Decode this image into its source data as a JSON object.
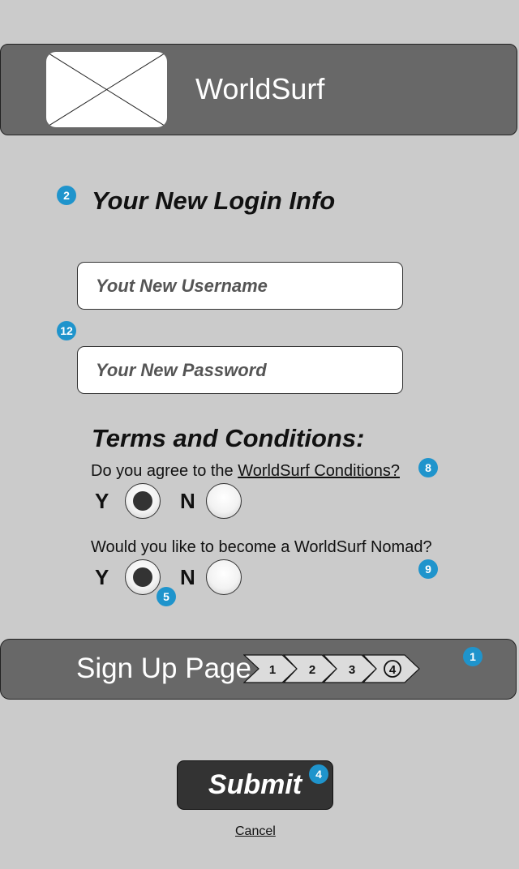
{
  "header": {
    "brand": "WorldSurf",
    "logo_icon": "image-placeholder-icon"
  },
  "form": {
    "title": "Your New Login Info",
    "username_placeholder": "Yout New Username",
    "password_placeholder": "Your New Password"
  },
  "terms": {
    "heading": "Terms and Conditions:",
    "q1_prefix": "Do you agree to the ",
    "q1_link": "WorldSurf Conditions?",
    "q1_selected": "Y",
    "q2": "Would you like to become a WorldSurf Nomad?",
    "q2_selected": "Y",
    "yes_label": "Y",
    "no_label": "N"
  },
  "progress": {
    "label": "Sign Up Page",
    "steps": [
      "1",
      "2",
      "3",
      "4"
    ],
    "current_step": 4
  },
  "actions": {
    "submit": "Submit",
    "cancel": "Cancel"
  },
  "annotations": {
    "title": "2",
    "fields": "12",
    "terms_q1": "8",
    "terms_q2": "9",
    "radio": "5",
    "progress": "1",
    "submit": "4"
  },
  "colors": {
    "badge": "#1f94cc",
    "bar": "#686868",
    "background": "#cbcbcb",
    "button": "#333333"
  }
}
